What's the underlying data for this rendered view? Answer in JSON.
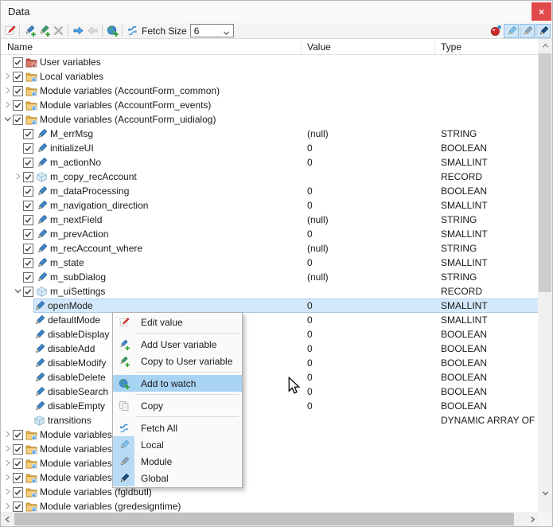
{
  "window": {
    "title": "Data",
    "close_glyph": "×"
  },
  "toolbar": {
    "fetch_size_label": "Fetch Size",
    "fetch_size_value": "6",
    "left_items": [
      {
        "type": "button",
        "name": "edit-value-button",
        "icon": "edit-value",
        "enabled": true
      },
      {
        "type": "separator"
      },
      {
        "type": "button",
        "name": "add-user-variable-button",
        "icon": "add-user-variable",
        "enabled": true
      },
      {
        "type": "button",
        "name": "copy-to-user-variable-button",
        "icon": "copy-to-user-variable",
        "enabled": true
      },
      {
        "type": "button",
        "name": "delete-variable-button",
        "icon": "delete-x",
        "enabled": false
      },
      {
        "type": "separator"
      },
      {
        "type": "button",
        "name": "next-button",
        "icon": "arrow-right",
        "enabled": true
      },
      {
        "type": "button",
        "name": "previous-button",
        "icon": "arrow-left",
        "enabled": false
      },
      {
        "type": "separator"
      },
      {
        "type": "button",
        "name": "add-to-watch-button",
        "icon": "watch-globe",
        "enabled": true
      },
      {
        "type": "separator"
      },
      {
        "type": "button",
        "name": "fetch-button",
        "icon": "fetch",
        "enabled": true
      }
    ],
    "right_items": [
      {
        "type": "icon",
        "name": "stop-on-error-icon",
        "icon": "error-ball"
      },
      {
        "type": "toggle",
        "name": "local-filter-toggle",
        "icon": "pencil-local",
        "pressed": true
      },
      {
        "type": "toggle",
        "name": "module-filter-toggle",
        "icon": "pencil-module",
        "pressed": true
      },
      {
        "type": "toggle",
        "name": "global-filter-toggle",
        "icon": "pencil-global",
        "pressed": true
      }
    ]
  },
  "columns": {
    "name": "Name",
    "value": "Value",
    "type": "Type"
  },
  "tree": {
    "rows": [
      {
        "level": 0,
        "expander": "none",
        "checkbox": true,
        "icon": "folder-user",
        "label": "User variables",
        "value": "",
        "type": ""
      },
      {
        "level": 0,
        "expander": "collapsed",
        "checkbox": true,
        "icon": "folder-module",
        "label": "Local variables",
        "value": "",
        "type": ""
      },
      {
        "level": 0,
        "expander": "collapsed",
        "checkbox": true,
        "icon": "folder-module",
        "label": "Module variables (AccountForm_common)",
        "value": "",
        "type": ""
      },
      {
        "level": 0,
        "expander": "collapsed",
        "checkbox": true,
        "icon": "folder-module",
        "label": "Module variables (AccountForm_events)",
        "value": "",
        "type": ""
      },
      {
        "level": 0,
        "expander": "expanded",
        "checkbox": true,
        "icon": "folder-module",
        "label": "Module variables (AccountForm_uidialog)",
        "value": "",
        "type": ""
      },
      {
        "level": 1,
        "expander": "none",
        "checkbox": true,
        "icon": "variable",
        "label": "M_errMsg",
        "value": "(null)",
        "type": "STRING"
      },
      {
        "level": 1,
        "expander": "none",
        "checkbox": true,
        "icon": "variable",
        "label": "initializeUI",
        "value": "0",
        "type": "BOOLEAN"
      },
      {
        "level": 1,
        "expander": "none",
        "checkbox": true,
        "icon": "variable",
        "label": "m_actionNo",
        "value": "0",
        "type": "SMALLINT"
      },
      {
        "level": 1,
        "expander": "collapsed",
        "checkbox": true,
        "icon": "record",
        "label": "m_copy_recAccount",
        "value": "",
        "type": "RECORD"
      },
      {
        "level": 1,
        "expander": "none",
        "checkbox": true,
        "icon": "variable",
        "label": "m_dataProcessing",
        "value": "0",
        "type": "BOOLEAN"
      },
      {
        "level": 1,
        "expander": "none",
        "checkbox": true,
        "icon": "variable",
        "label": "m_navigation_direction",
        "value": "0",
        "type": "SMALLINT"
      },
      {
        "level": 1,
        "expander": "none",
        "checkbox": true,
        "icon": "variable",
        "label": "m_nextField",
        "value": "(null)",
        "type": "STRING"
      },
      {
        "level": 1,
        "expander": "none",
        "checkbox": true,
        "icon": "variable",
        "label": "m_prevAction",
        "value": "0",
        "type": "SMALLINT"
      },
      {
        "level": 1,
        "expander": "none",
        "checkbox": true,
        "icon": "variable",
        "label": "m_recAccount_where",
        "value": "(null)",
        "type": "STRING"
      },
      {
        "level": 1,
        "expander": "none",
        "checkbox": true,
        "icon": "variable",
        "label": "m_state",
        "value": "0",
        "type": "SMALLINT"
      },
      {
        "level": 1,
        "expander": "none",
        "checkbox": true,
        "icon": "variable",
        "label": "m_subDialog",
        "value": "(null)",
        "type": "STRING"
      },
      {
        "level": 1,
        "expander": "expanded",
        "checkbox": true,
        "icon": "record",
        "label": "m_uiSettings",
        "value": "",
        "type": "RECORD"
      },
      {
        "level": 2,
        "expander": "none",
        "checkbox": false,
        "icon": "variable",
        "label": "openMode",
        "value": "0",
        "type": "SMALLINT",
        "selected": true
      },
      {
        "level": 2,
        "expander": "none",
        "checkbox": false,
        "icon": "variable",
        "label": "defaultMode",
        "value": "0",
        "type": "SMALLINT"
      },
      {
        "level": 2,
        "expander": "none",
        "checkbox": false,
        "icon": "variable",
        "label": "disableDisplay",
        "value": "0",
        "type": "BOOLEAN"
      },
      {
        "level": 2,
        "expander": "none",
        "checkbox": false,
        "icon": "variable",
        "label": "disableAdd",
        "value": "0",
        "type": "BOOLEAN"
      },
      {
        "level": 2,
        "expander": "none",
        "checkbox": false,
        "icon": "variable",
        "label": "disableModify",
        "value": "0",
        "type": "BOOLEAN"
      },
      {
        "level": 2,
        "expander": "none",
        "checkbox": false,
        "icon": "variable",
        "label": "disableDelete",
        "value": "0",
        "type": "BOOLEAN"
      },
      {
        "level": 2,
        "expander": "none",
        "checkbox": false,
        "icon": "variable",
        "label": "disableSearch",
        "value": "0",
        "type": "BOOLEAN"
      },
      {
        "level": 2,
        "expander": "none",
        "checkbox": false,
        "icon": "variable",
        "label": "disableEmpty",
        "value": "0",
        "type": "BOOLEAN"
      },
      {
        "level": 2,
        "expander": "none",
        "checkbox": false,
        "icon": "array",
        "label": "transitions",
        "value": "",
        "type": "DYNAMIC ARRAY OF RECO"
      },
      {
        "level": 0,
        "expander": "collapsed",
        "checkbox": true,
        "icon": "folder-module",
        "label": "Module variables",
        "value": "",
        "type": ""
      },
      {
        "level": 0,
        "expander": "collapsed",
        "checkbox": true,
        "icon": "folder-module",
        "label": "Module variables",
        "value": "",
        "type": ""
      },
      {
        "level": 0,
        "expander": "collapsed",
        "checkbox": true,
        "icon": "folder-module",
        "label": "Module variables",
        "value": "",
        "type": ""
      },
      {
        "level": 0,
        "expander": "collapsed",
        "checkbox": true,
        "icon": "folder-module",
        "label": "Module variables",
        "value": "",
        "type": ""
      },
      {
        "level": 0,
        "expander": "collapsed",
        "checkbox": true,
        "icon": "folder-module",
        "label": "Module variables (fgldbutl)",
        "value": "",
        "type": ""
      },
      {
        "level": 0,
        "expander": "collapsed",
        "checkbox": true,
        "icon": "folder-module",
        "label": "Module variables (gredesigntime)",
        "value": "",
        "type": ""
      }
    ]
  },
  "context_menu": {
    "items": [
      {
        "type": "item",
        "name": "menu-edit-value",
        "icon": "edit-value",
        "label": "Edit value"
      },
      {
        "type": "separator"
      },
      {
        "type": "item",
        "name": "menu-add-user-variable",
        "icon": "add-user-variable",
        "label": "Add User variable"
      },
      {
        "type": "item",
        "name": "menu-copy-to-user-variable",
        "icon": "copy-to-user-variable",
        "label": "Copy to User variable"
      },
      {
        "type": "separator"
      },
      {
        "type": "item",
        "name": "menu-add-to-watch",
        "icon": "watch-globe",
        "label": "Add to watch",
        "highlighted": true
      },
      {
        "type": "separator"
      },
      {
        "type": "item",
        "name": "menu-copy",
        "icon": "copy",
        "label": "Copy"
      },
      {
        "type": "separator"
      },
      {
        "type": "item",
        "name": "menu-fetch-all",
        "icon": "fetch",
        "label": "Fetch All"
      },
      {
        "type": "item",
        "name": "menu-local",
        "icon": "pencil-local",
        "label": "Local",
        "gutter": true
      },
      {
        "type": "item",
        "name": "menu-module",
        "icon": "pencil-module",
        "label": "Module",
        "gutter": true
      },
      {
        "type": "item",
        "name": "menu-global",
        "icon": "pencil-global",
        "label": "Global",
        "gutter": true
      }
    ]
  },
  "colors": {
    "close_button": "#e04a4a",
    "selection_fill": "#d3e9fb",
    "selection_border": "#a9cbe9",
    "menu_highlight": "#a9d3f3",
    "toggle_fill": "#cfe5f7",
    "accent_blue": "#2f86c8"
  }
}
